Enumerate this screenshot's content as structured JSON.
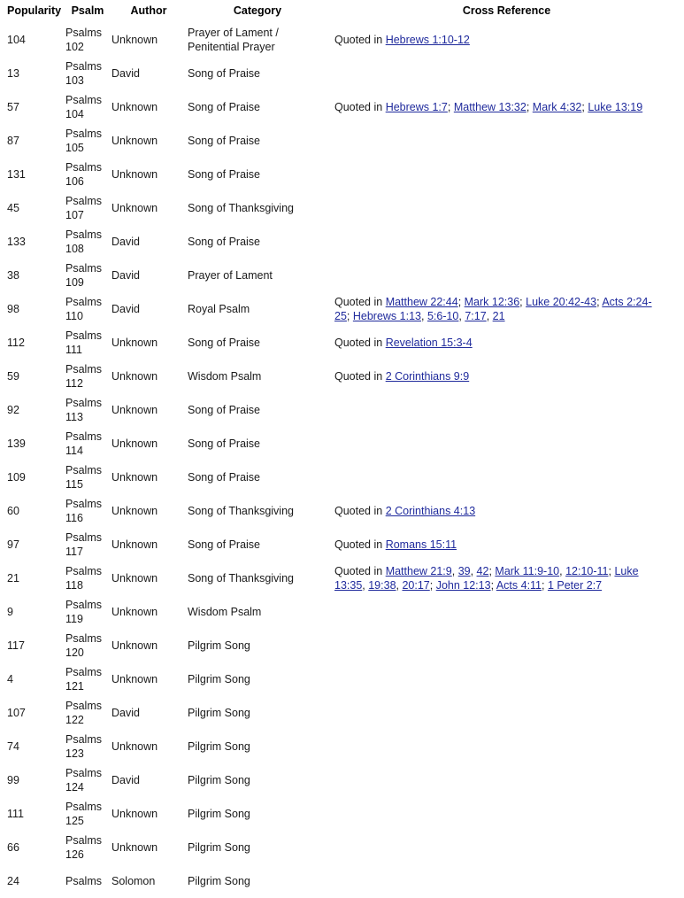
{
  "headers": {
    "popularity": "Popularity",
    "psalm": "Psalm",
    "author": "Author",
    "category": "Category",
    "cross_reference": "Cross Reference"
  },
  "link_color": "#1f2a9c",
  "rows": [
    {
      "popularity": "104",
      "psalm_line1": "Psalms",
      "psalm_line2": "102",
      "author": "Unknown",
      "category": "Prayer of Lament / Penitential Prayer",
      "ref": [
        {
          "t": "Quoted in "
        },
        {
          "l": "Hebrews 1:10-12"
        }
      ]
    },
    {
      "popularity": "13",
      "psalm_line1": "Psalms",
      "psalm_line2": "103",
      "author": "David",
      "category": "Song of Praise",
      "ref": []
    },
    {
      "popularity": "57",
      "psalm_line1": "Psalms",
      "psalm_line2": "104",
      "author": "Unknown",
      "category": "Song of Praise",
      "ref": [
        {
          "t": "Quoted in "
        },
        {
          "l": "Hebrews 1:7"
        },
        {
          "t": "; "
        },
        {
          "l": "Matthew 13:32"
        },
        {
          "t": "; "
        },
        {
          "l": "Mark 4:32"
        },
        {
          "t": "; "
        },
        {
          "l": "Luke 13:19"
        }
      ]
    },
    {
      "popularity": "87",
      "psalm_line1": "Psalms",
      "psalm_line2": "105",
      "author": "Unknown",
      "category": "Song of Praise",
      "ref": []
    },
    {
      "popularity": "131",
      "psalm_line1": "Psalms",
      "psalm_line2": "106",
      "author": "Unknown",
      "category": "Song of Praise",
      "ref": []
    },
    {
      "popularity": "45",
      "psalm_line1": "Psalms",
      "psalm_line2": "107",
      "author": "Unknown",
      "category": "Song of Thanksgiving",
      "ref": []
    },
    {
      "popularity": "133",
      "psalm_line1": "Psalms",
      "psalm_line2": "108",
      "author": "David",
      "category": "Song of Praise",
      "ref": []
    },
    {
      "popularity": "38",
      "psalm_line1": "Psalms",
      "psalm_line2": "109",
      "author": "David",
      "category": "Prayer of Lament",
      "ref": []
    },
    {
      "popularity": "98",
      "psalm_line1": "Psalms",
      "psalm_line2": "110",
      "author": "David",
      "category": "Royal Psalm",
      "ref": [
        {
          "t": "Quoted in "
        },
        {
          "l": "Matthew 22:44"
        },
        {
          "t": "; "
        },
        {
          "l": "Mark 12:36"
        },
        {
          "t": "; "
        },
        {
          "l": "Luke 20:42-43"
        },
        {
          "t": "; "
        },
        {
          "l": "Acts 2:24-25"
        },
        {
          "t": "; "
        },
        {
          "l": "Hebrews 1:13"
        },
        {
          "t": ", "
        },
        {
          "l": "5:6-10"
        },
        {
          "t": ", "
        },
        {
          "l": "7:17"
        },
        {
          "t": ", "
        },
        {
          "l": "21"
        }
      ]
    },
    {
      "popularity": "112",
      "psalm_line1": "Psalms",
      "psalm_line2": "111",
      "author": "Unknown",
      "category": "Song of Praise",
      "ref": [
        {
          "t": "Quoted in "
        },
        {
          "l": "Revelation 15:3-4"
        }
      ]
    },
    {
      "popularity": "59",
      "psalm_line1": "Psalms",
      "psalm_line2": "112",
      "author": "Unknown",
      "category": "Wisdom Psalm",
      "ref": [
        {
          "t": "Quoted in "
        },
        {
          "l": "2 Corinthians 9:9"
        }
      ]
    },
    {
      "popularity": "92",
      "psalm_line1": "Psalms",
      "psalm_line2": "113",
      "author": "Unknown",
      "category": "Song of Praise",
      "ref": []
    },
    {
      "popularity": "139",
      "psalm_line1": "Psalms",
      "psalm_line2": "114",
      "author": "Unknown",
      "category": "Song of Praise",
      "ref": []
    },
    {
      "popularity": "109",
      "psalm_line1": "Psalms",
      "psalm_line2": "115",
      "author": "Unknown",
      "category": "Song of Praise",
      "ref": []
    },
    {
      "popularity": "60",
      "psalm_line1": "Psalms",
      "psalm_line2": "116",
      "author": "Unknown",
      "category": "Song of Thanksgiving",
      "ref": [
        {
          "t": "Quoted in "
        },
        {
          "l": "2 Corinthians 4:13"
        }
      ]
    },
    {
      "popularity": "97",
      "psalm_line1": "Psalms",
      "psalm_line2": "117",
      "author": "Unknown",
      "category": "Song of Praise",
      "ref": [
        {
          "t": "Quoted in "
        },
        {
          "l": "Romans 15:11"
        }
      ]
    },
    {
      "popularity": "21",
      "psalm_line1": "Psalms",
      "psalm_line2": "118",
      "author": "Unknown",
      "category": "Song of Thanksgiving",
      "ref": [
        {
          "t": "Quoted in "
        },
        {
          "l": "Matthew 21:9"
        },
        {
          "t": ", "
        },
        {
          "l": "39"
        },
        {
          "t": ", "
        },
        {
          "l": "42"
        },
        {
          "t": "; "
        },
        {
          "l": "Mark 11:9-10"
        },
        {
          "t": ", "
        },
        {
          "l": "12:10-11"
        },
        {
          "t": "; "
        },
        {
          "l": "Luke 13:35"
        },
        {
          "t": ", "
        },
        {
          "l": "19:38"
        },
        {
          "t": ", "
        },
        {
          "l": "20:17"
        },
        {
          "t": "; "
        },
        {
          "l": "John 12:13"
        },
        {
          "t": "; "
        },
        {
          "l": "Acts 4:11"
        },
        {
          "t": "; "
        },
        {
          "l": "1 Peter 2:7"
        }
      ]
    },
    {
      "popularity": "9",
      "psalm_line1": "Psalms",
      "psalm_line2": "119",
      "author": "Unknown",
      "category": "Wisdom Psalm",
      "ref": []
    },
    {
      "popularity": "117",
      "psalm_line1": "Psalms",
      "psalm_line2": "120",
      "author": "Unknown",
      "category": "Pilgrim Song",
      "ref": []
    },
    {
      "popularity": "4",
      "psalm_line1": "Psalms",
      "psalm_line2": "121",
      "author": "Unknown",
      "category": "Pilgrim Song",
      "ref": []
    },
    {
      "popularity": "107",
      "psalm_line1": "Psalms",
      "psalm_line2": "122",
      "author": "David",
      "category": "Pilgrim Song",
      "ref": []
    },
    {
      "popularity": "74",
      "psalm_line1": "Psalms",
      "psalm_line2": "123",
      "author": "Unknown",
      "category": "Pilgrim Song",
      "ref": []
    },
    {
      "popularity": "99",
      "psalm_line1": "Psalms",
      "psalm_line2": "124",
      "author": "David",
      "category": "Pilgrim Song",
      "ref": []
    },
    {
      "popularity": "111",
      "psalm_line1": "Psalms",
      "psalm_line2": "125",
      "author": "Unknown",
      "category": "Pilgrim Song",
      "ref": []
    },
    {
      "popularity": "66",
      "psalm_line1": "Psalms",
      "psalm_line2": "126",
      "author": "Unknown",
      "category": "Pilgrim Song",
      "ref": []
    },
    {
      "popularity": "24",
      "psalm_line1": "Psalms",
      "psalm_line2": "",
      "author": "Solomon",
      "category": "Pilgrim Song",
      "ref": []
    }
  ]
}
